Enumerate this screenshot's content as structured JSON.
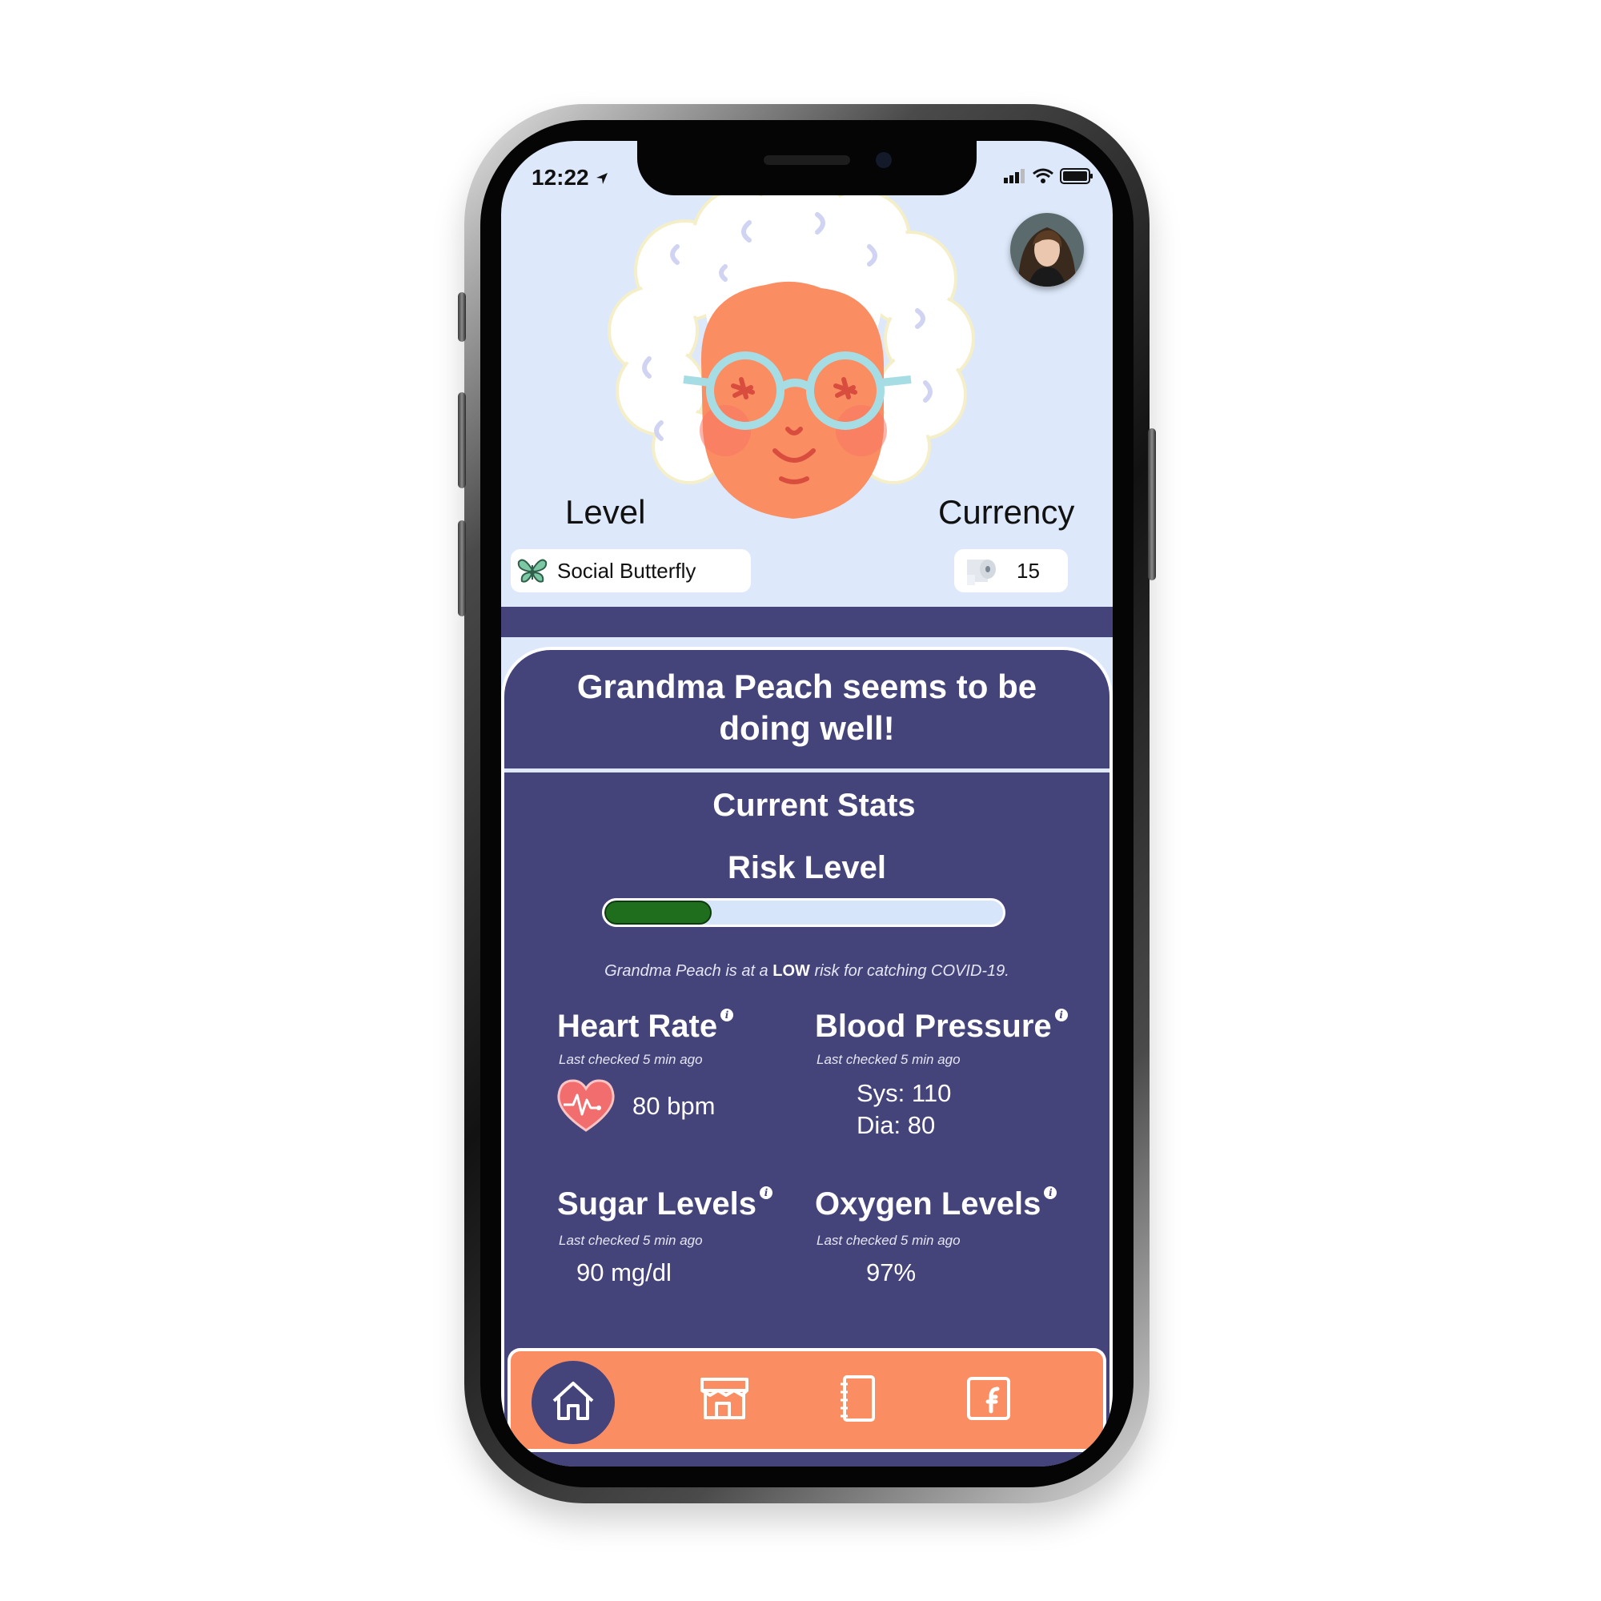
{
  "status_bar": {
    "time": "12:22"
  },
  "profile": {
    "level_label": "Level",
    "level_name": "Social Butterfly",
    "currency_label": "Currency",
    "currency_value": "15"
  },
  "headline": {
    "line1": "Grandma Peach seems to be",
    "line2": "doing well!"
  },
  "stats": {
    "title": "Current Stats",
    "risk": {
      "title": "Risk Level",
      "level": 0.27,
      "text_before": "Grandma Peach is at a ",
      "text_level": "LOW",
      "text_after": " risk for catching COVID-19."
    },
    "heart_rate": {
      "title": "Heart Rate",
      "sub": "Last checked 5 min ago",
      "value": "80 bpm"
    },
    "blood_pressure": {
      "title": "Blood Pressure",
      "sub": "Last checked 5 min ago",
      "sys": "Sys: 110",
      "dia": "Dia: 80"
    },
    "sugar": {
      "title": "Sugar Levels",
      "sub": "Last checked 5 min ago",
      "value": "90 mg/dl"
    },
    "oxygen": {
      "title": "Oxygen Levels",
      "sub": "Last checked 5 min ago",
      "value": "97%"
    }
  },
  "nav": {
    "items": [
      "home-icon",
      "store-icon",
      "notebook-icon",
      "facebook-icon"
    ],
    "active": "home-icon"
  },
  "colors": {
    "panel": "#44437a",
    "sky": "#dde9fb",
    "nav": "#fb8d62",
    "risk_fill": "#1e6e1e"
  }
}
